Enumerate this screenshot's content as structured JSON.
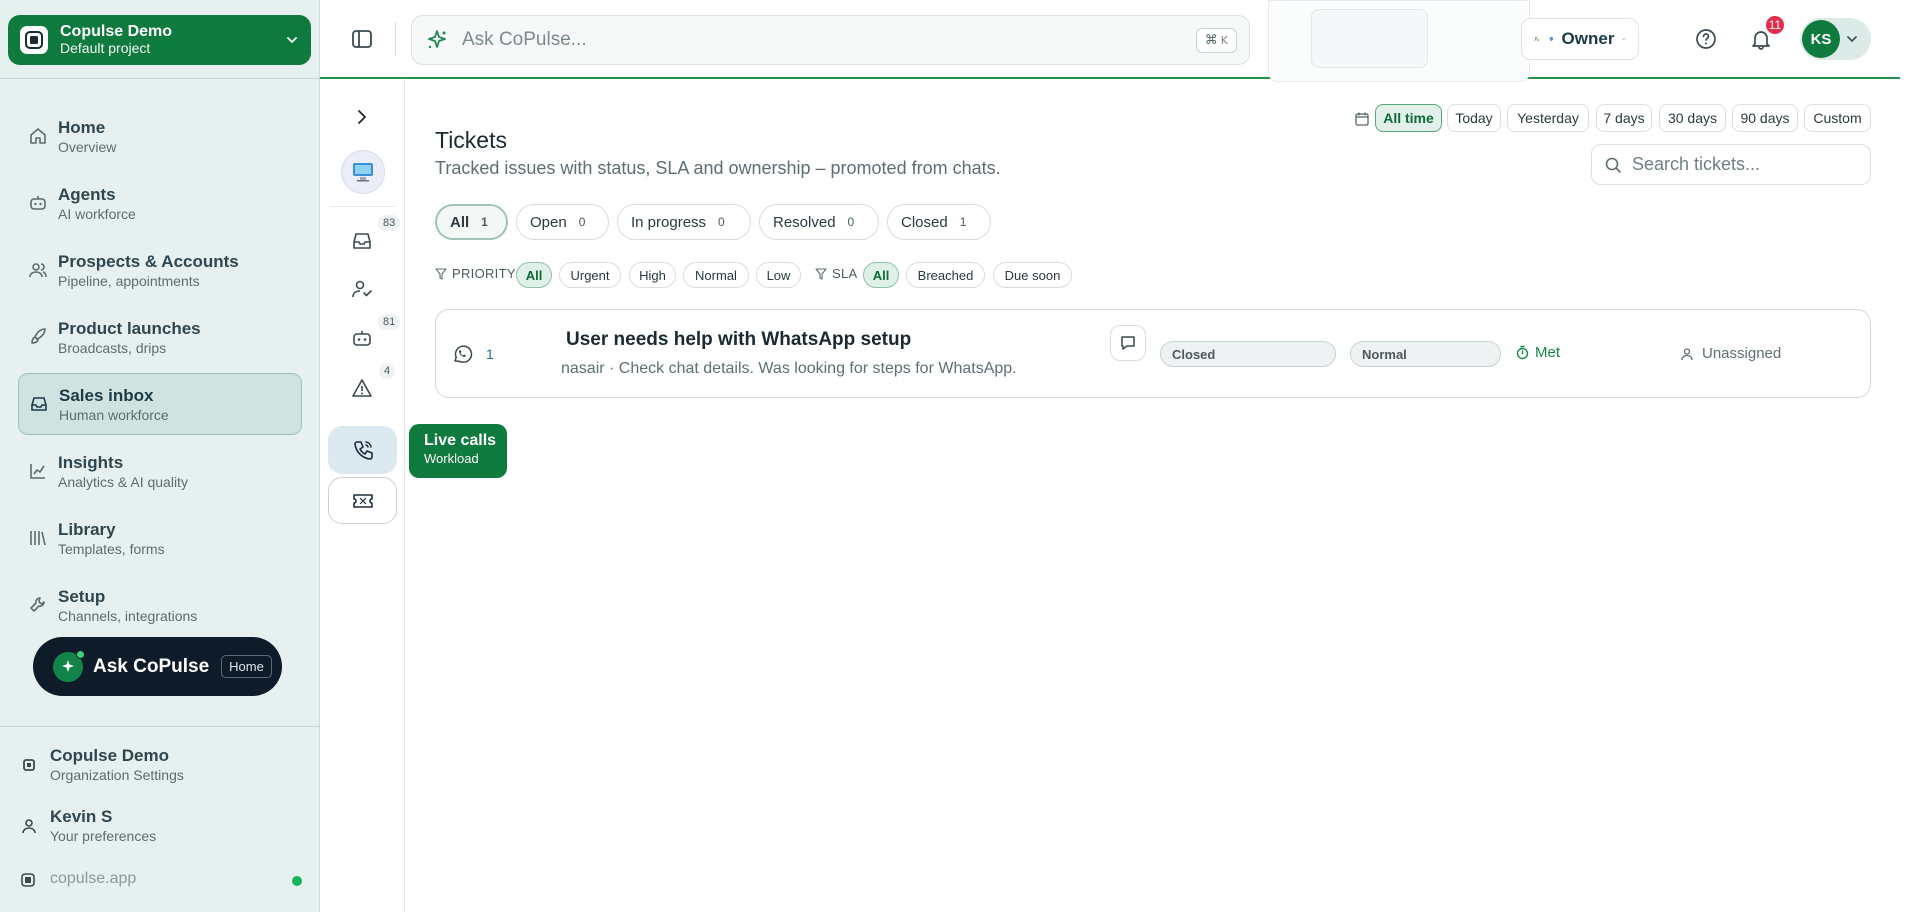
{
  "project": {
    "name": "Copulse Demo",
    "subtitle": "Default project"
  },
  "nav": {
    "items": [
      {
        "title": "Home",
        "subtitle": "Overview",
        "icon": "home-icon"
      },
      {
        "title": "Agents",
        "subtitle": "AI workforce",
        "icon": "bot-icon"
      },
      {
        "title": "Prospects & Accounts",
        "subtitle": "Pipeline, appointments",
        "icon": "users-icon"
      },
      {
        "title": "Product launches",
        "subtitle": "Broadcasts, drips",
        "icon": "rocket-icon"
      },
      {
        "title": "Sales inbox",
        "subtitle": "Human workforce",
        "icon": "inbox-icon",
        "active": true
      },
      {
        "title": "Insights",
        "subtitle": "Analytics & AI quality",
        "icon": "chart-icon"
      },
      {
        "title": "Library",
        "subtitle": "Templates, forms",
        "icon": "library-icon"
      },
      {
        "title": "Setup",
        "subtitle": "Channels, integrations",
        "icon": "wrench-icon"
      }
    ]
  },
  "ask_pill": {
    "label": "Ask CoPulse",
    "badge": "Home"
  },
  "footer": {
    "org": {
      "title": "Copulse Demo",
      "subtitle": "Organization Settings"
    },
    "user": {
      "title": "Kevin S",
      "subtitle": "Your preferences"
    },
    "domain": "copulse.app"
  },
  "topbar": {
    "search_placeholder": "Ask CoPulse...",
    "shortcut_symbol": "⌘",
    "shortcut_key": "K",
    "role": "Owner",
    "notifications": "11",
    "avatar_initials": "KS"
  },
  "rail": {
    "inbox_count": "83",
    "agents_count": "81",
    "alerts_count": "4"
  },
  "tooltip": {
    "title": "Live calls",
    "subtitle": "Workload"
  },
  "main": {
    "title": "Tickets",
    "subtitle": "Tracked issues with status, SLA and ownership – promoted from chats.",
    "date_ranges": [
      "All time",
      "Today",
      "Yesterday",
      "7 days",
      "30 days",
      "90 days",
      "Custom"
    ],
    "active_date_range": "All time",
    "search_placeholder": "Search tickets...",
    "status_tabs": [
      {
        "label": "All",
        "count": "1"
      },
      {
        "label": "Open",
        "count": "0"
      },
      {
        "label": "In progress",
        "count": "0"
      },
      {
        "label": "Resolved",
        "count": "0"
      },
      {
        "label": "Closed",
        "count": "1"
      }
    ],
    "priority_label": "PRIORITY",
    "priority_filters": [
      "All",
      "Urgent",
      "High",
      "Normal",
      "Low"
    ],
    "sla_label": "SLA",
    "sla_filters": [
      "All",
      "Breached",
      "Due soon"
    ]
  },
  "tickets": [
    {
      "id": "1",
      "title": "User needs help with WhatsApp setup",
      "meta": "nasair · Check chat details. Was looking for steps for WhatsApp.",
      "status": "Closed",
      "priority": "Normal",
      "sla": "Met",
      "assignee": "Unassigned",
      "channel_icon": "whatsapp-icon"
    }
  ],
  "colors": {
    "brand": "#0f7a3e",
    "sidebar_bg": "#e6f0ee",
    "badge_red": "#e22d4b",
    "sla_ok": "#128a46"
  }
}
